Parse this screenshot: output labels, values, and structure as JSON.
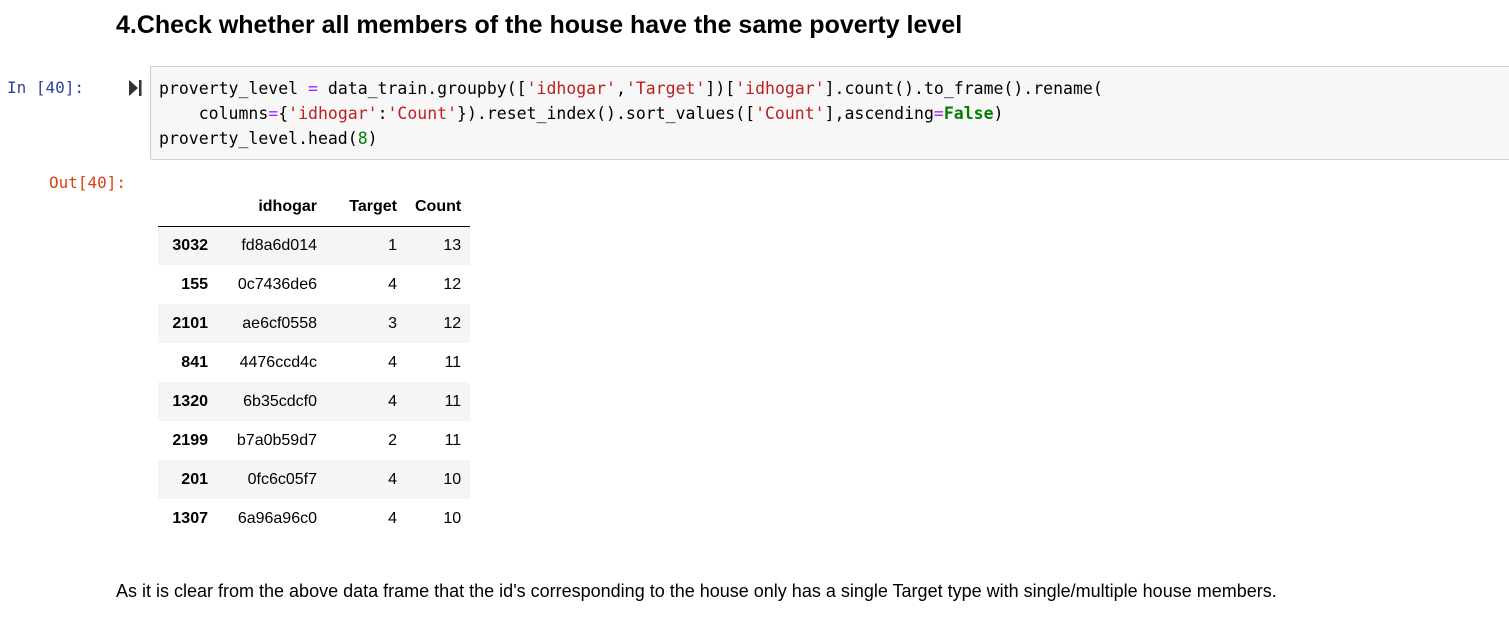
{
  "markdown": {
    "heading": "4.Check whether all members of the house have the same poverty level",
    "conclusion": "As it is clear from the above data frame that the id's corresponding to the house only has a single Target type with single/multiple house members."
  },
  "code_cell": {
    "in_prompt": "In [40]:",
    "run_icon": "run-cell-icon",
    "lines": [
      [
        {
          "t": "proverty_level ",
          "c": "plain"
        },
        {
          "t": "=",
          "c": "op"
        },
        {
          "t": " data_train.groupby([",
          "c": "plain"
        },
        {
          "t": "'idhogar'",
          "c": "str"
        },
        {
          "t": ",",
          "c": "plain"
        },
        {
          "t": "'Target'",
          "c": "str"
        },
        {
          "t": "])[",
          "c": "plain"
        },
        {
          "t": "'idhogar'",
          "c": "str"
        },
        {
          "t": "].count().to_frame().rename(",
          "c": "plain"
        }
      ],
      [
        {
          "t": "    columns",
          "c": "plain"
        },
        {
          "t": "=",
          "c": "op"
        },
        {
          "t": "{",
          "c": "plain"
        },
        {
          "t": "'idhogar'",
          "c": "str"
        },
        {
          "t": ":",
          "c": "plain"
        },
        {
          "t": "'Count'",
          "c": "str"
        },
        {
          "t": "}).reset_index().sort_values([",
          "c": "plain"
        },
        {
          "t": "'Count'",
          "c": "str"
        },
        {
          "t": "],ascending",
          "c": "plain"
        },
        {
          "t": "=",
          "c": "op"
        },
        {
          "t": "False",
          "c": "kw"
        },
        {
          "t": ")",
          "c": "plain"
        }
      ],
      [
        {
          "t": "proverty_level.head(",
          "c": "plain"
        },
        {
          "t": "8",
          "c": "num"
        },
        {
          "t": ")",
          "c": "plain"
        }
      ]
    ]
  },
  "output_cell": {
    "out_prompt": "Out[40]:",
    "table": {
      "columns": [
        "idhogar",
        "Target",
        "Count"
      ],
      "rows": [
        {
          "index": "3032",
          "idhogar": "fd8a6d014",
          "Target": "1",
          "Count": "13"
        },
        {
          "index": "155",
          "idhogar": "0c7436de6",
          "Target": "4",
          "Count": "12"
        },
        {
          "index": "2101",
          "idhogar": "ae6cf0558",
          "Target": "3",
          "Count": "12"
        },
        {
          "index": "841",
          "idhogar": "4476ccd4c",
          "Target": "4",
          "Count": "11"
        },
        {
          "index": "1320",
          "idhogar": "6b35cdcf0",
          "Target": "4",
          "Count": "11"
        },
        {
          "index": "2199",
          "idhogar": "b7a0b59d7",
          "Target": "2",
          "Count": "11"
        },
        {
          "index": "201",
          "idhogar": "0fc6c05f7",
          "Target": "4",
          "Count": "10"
        },
        {
          "index": "1307",
          "idhogar": "6a96a96c0",
          "Target": "4",
          "Count": "10"
        }
      ]
    }
  },
  "colors": {
    "in_prompt": "#303F9F",
    "out_prompt": "#D84315",
    "code_background": "#f7f7f7",
    "string": "#BA2121",
    "operator": "#AA22FF",
    "keyword": "#008000"
  }
}
